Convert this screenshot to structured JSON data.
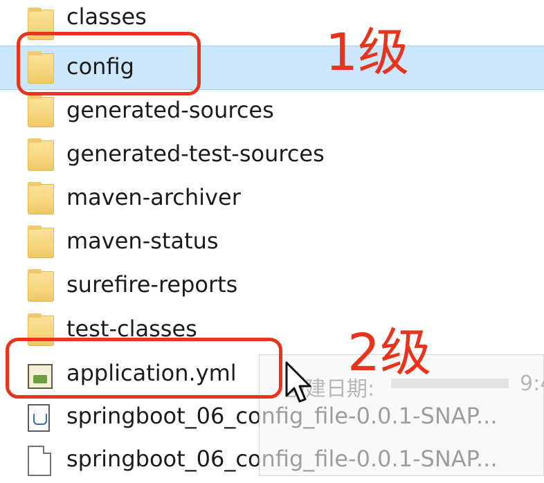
{
  "file_list": {
    "items": [
      {
        "label": "classes",
        "type": "folder",
        "selected": false
      },
      {
        "label": "config",
        "type": "folder",
        "selected": true
      },
      {
        "label": "generated-sources",
        "type": "folder",
        "selected": false
      },
      {
        "label": "generated-test-sources",
        "type": "folder",
        "selected": false
      },
      {
        "label": "maven-archiver",
        "type": "folder",
        "selected": false
      },
      {
        "label": "maven-status",
        "type": "folder",
        "selected": false
      },
      {
        "label": "surefire-reports",
        "type": "folder",
        "selected": false
      },
      {
        "label": "test-classes",
        "type": "folder",
        "selected": false
      },
      {
        "label": "application.yml",
        "type": "yml",
        "selected": false
      },
      {
        "label": "springboot_06_config_file-0.0.1-SNAP...",
        "type": "jar",
        "selected": false
      },
      {
        "label": "springboot_06_config_file-0.0.1-SNAP...",
        "type": "file",
        "selected": false
      }
    ]
  },
  "annotations": {
    "level1": "1级",
    "level2": "2级",
    "color": "#e8341d"
  },
  "tooltip": {
    "label": "创建日期:",
    "time": "9:4"
  },
  "selection_color": "#cce8ff"
}
